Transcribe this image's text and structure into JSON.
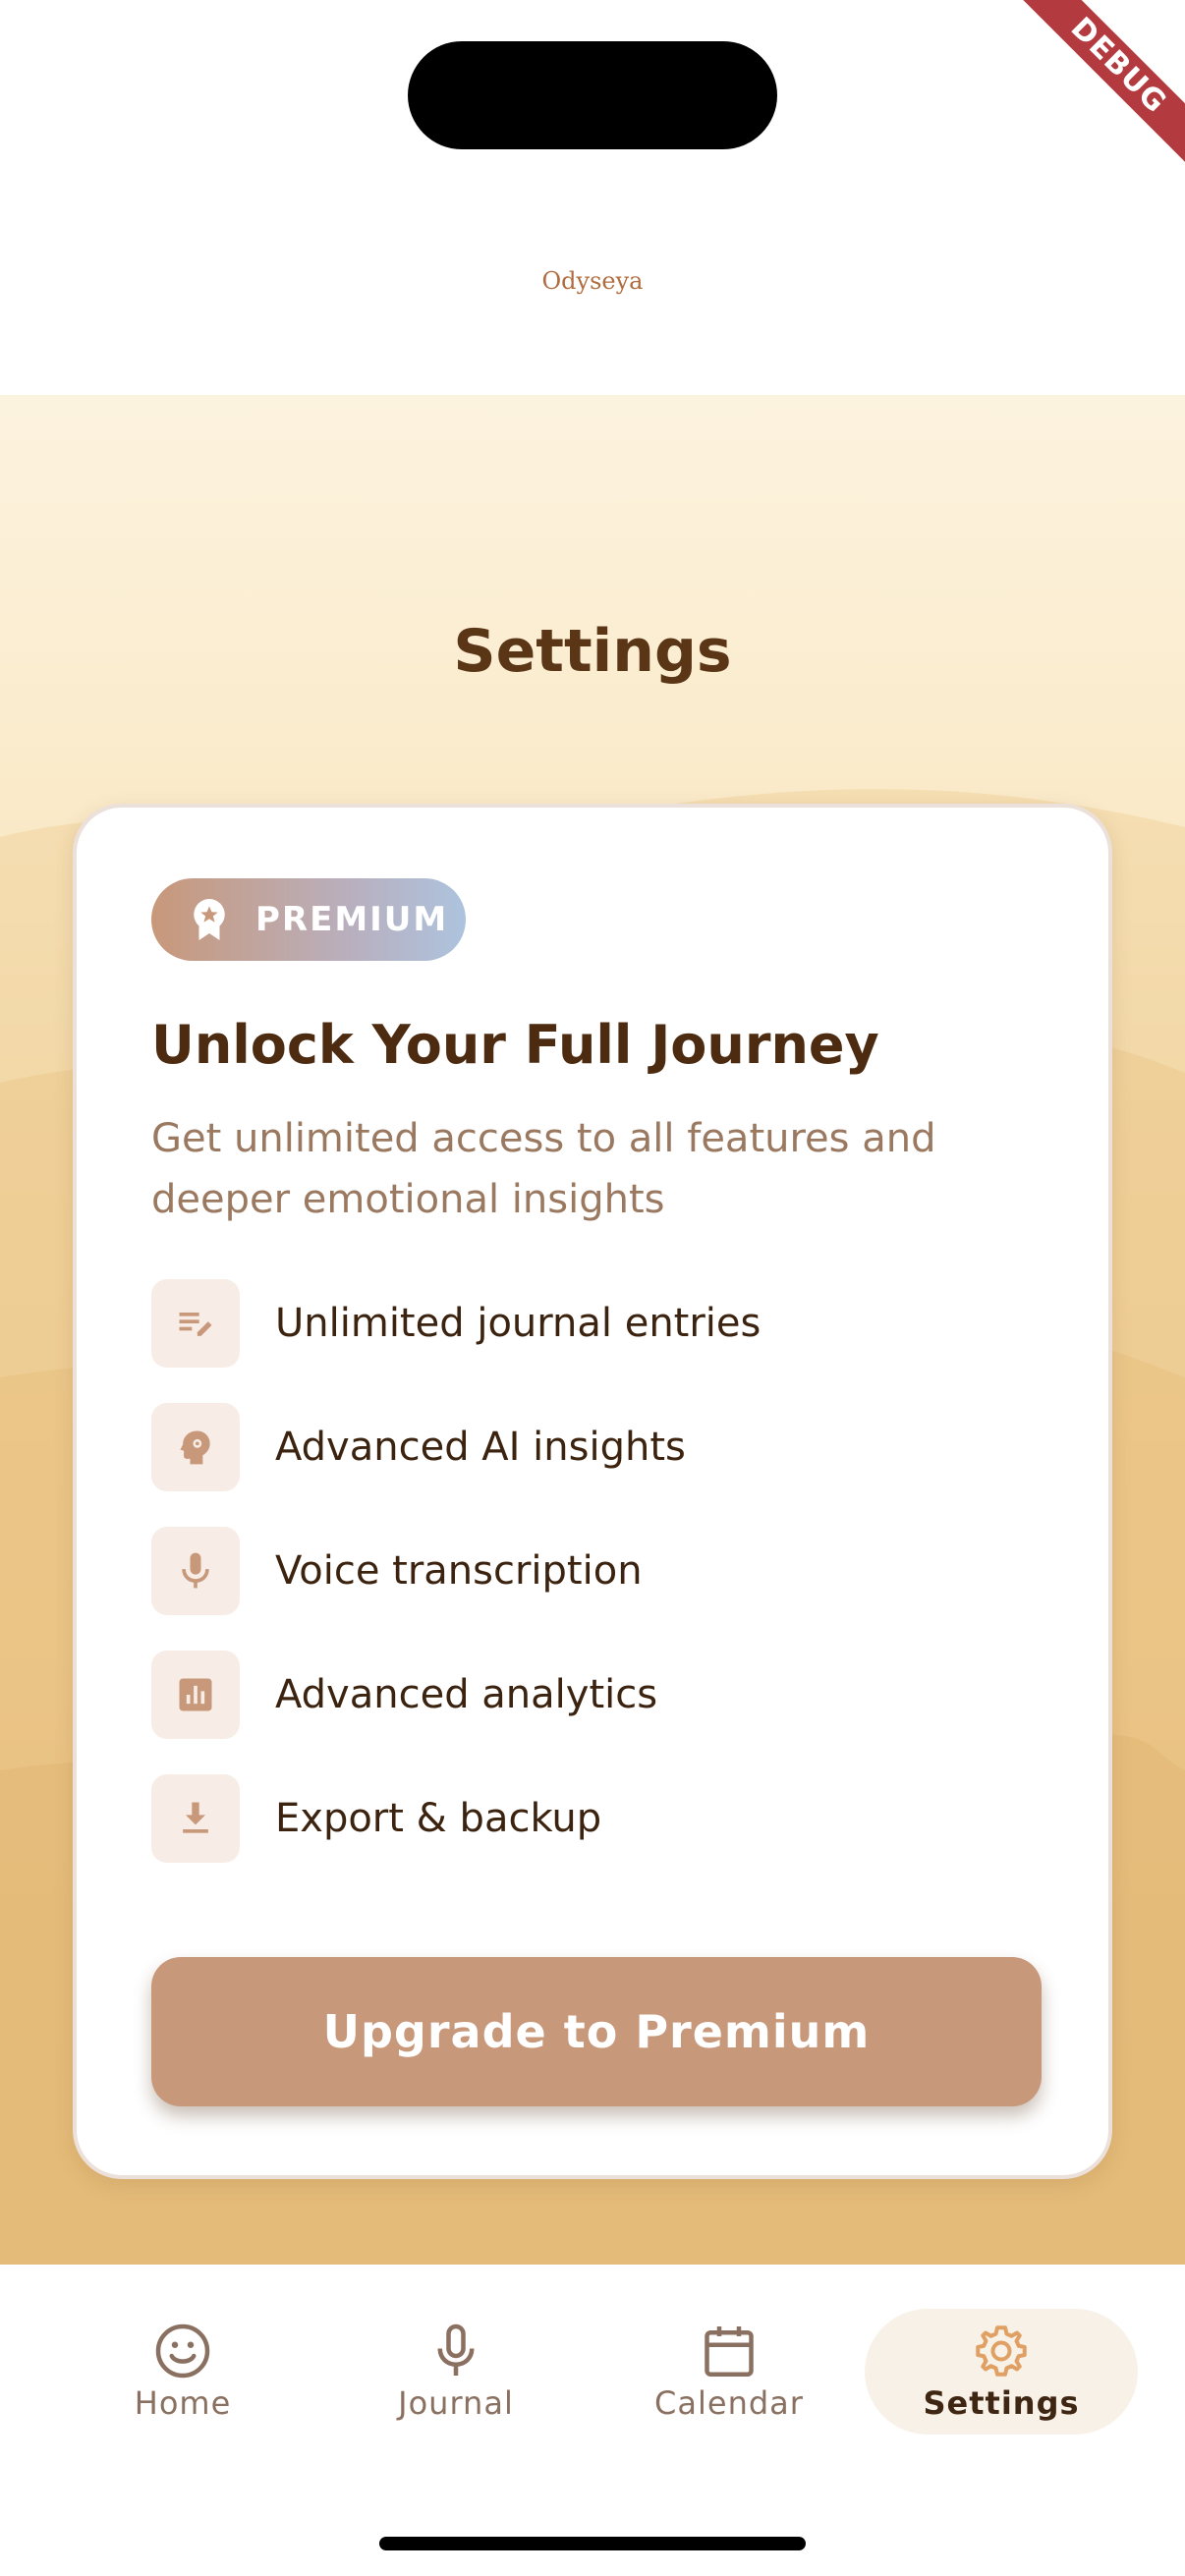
{
  "debug_banner": "DEBUG",
  "app": {
    "title": "Odyseya"
  },
  "page": {
    "title": "Settings"
  },
  "premium_card": {
    "badge_label": "PREMIUM",
    "headline": "Unlock Your Full Journey",
    "subtext": "Get unlimited access to all features and deeper emotional insights",
    "features": [
      {
        "icon": "edit-note-icon",
        "label": "Unlimited journal entries"
      },
      {
        "icon": "psychology-icon",
        "label": "Advanced AI insights"
      },
      {
        "icon": "mic-icon",
        "label": "Voice transcription"
      },
      {
        "icon": "analytics-icon",
        "label": "Advanced analytics"
      },
      {
        "icon": "download-icon",
        "label": "Export & backup"
      }
    ],
    "cta_label": "Upgrade to Premium"
  },
  "nav": {
    "items": [
      {
        "icon": "smiley-icon",
        "label": "Home",
        "active": false
      },
      {
        "icon": "mic-icon",
        "label": "Journal",
        "active": false
      },
      {
        "icon": "calendar-icon",
        "label": "Calendar",
        "active": false
      },
      {
        "icon": "gear-icon",
        "label": "Settings",
        "active": true
      }
    ]
  },
  "colors": {
    "accent": "#c8987a",
    "title_brown": "#5a3516",
    "active_icon": "#e0a064"
  }
}
